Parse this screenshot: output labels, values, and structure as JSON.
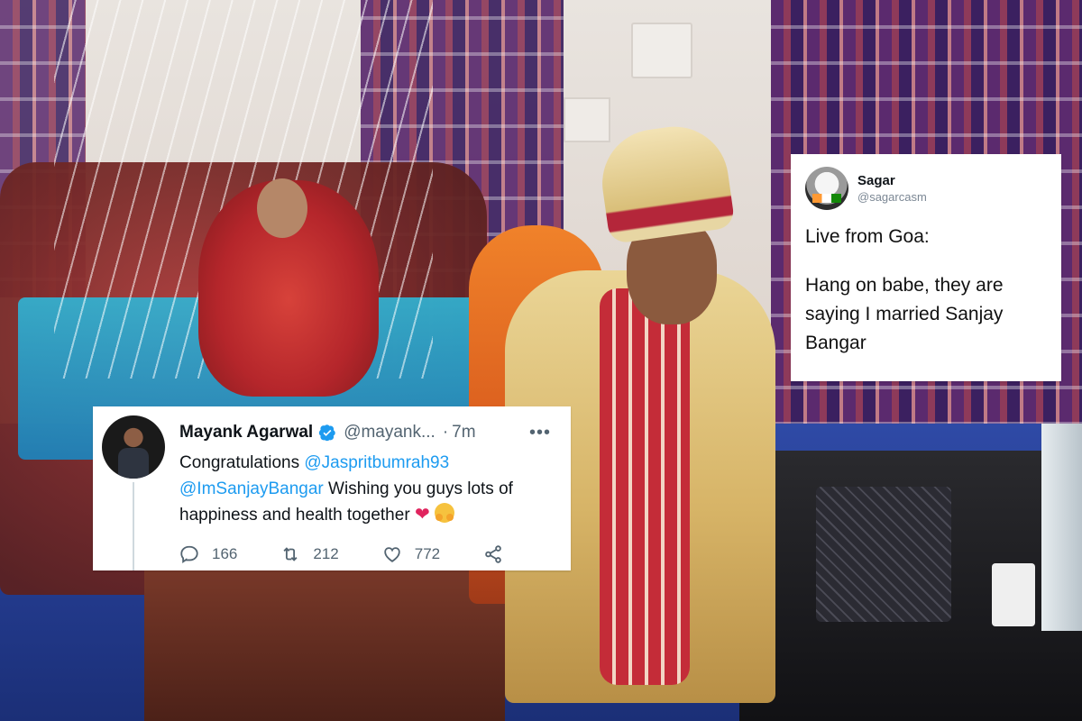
{
  "tweet_sagar": {
    "display_name": "Sagar",
    "handle": "@sagarcasm",
    "line1": "Live from Goa:",
    "line2": "Hang on babe, they are saying I married Sanjay Bangar"
  },
  "tweet_mayank": {
    "display_name": "Mayank Agarwal",
    "handle": "@mayank...",
    "separator": "·",
    "time": "7m",
    "more": "•••",
    "text_prefix": "Congratulations ",
    "mention1": "@Jaspritbumrah93",
    "mention2": "@ImSanjayBangar",
    "text_suffix": " Wishing you guys lots of happiness and health together ",
    "emoji1": "❤",
    "replies": "166",
    "retweets": "212",
    "likes": "772"
  },
  "colors": {
    "twitter_blue": "#1d9bf0",
    "heart_red": "#e0245e",
    "muted_gray": "#536471"
  },
  "icons": [
    "verified-badge-icon",
    "more-options-icon",
    "reply-icon",
    "retweet-icon",
    "like-icon",
    "share-icon"
  ]
}
